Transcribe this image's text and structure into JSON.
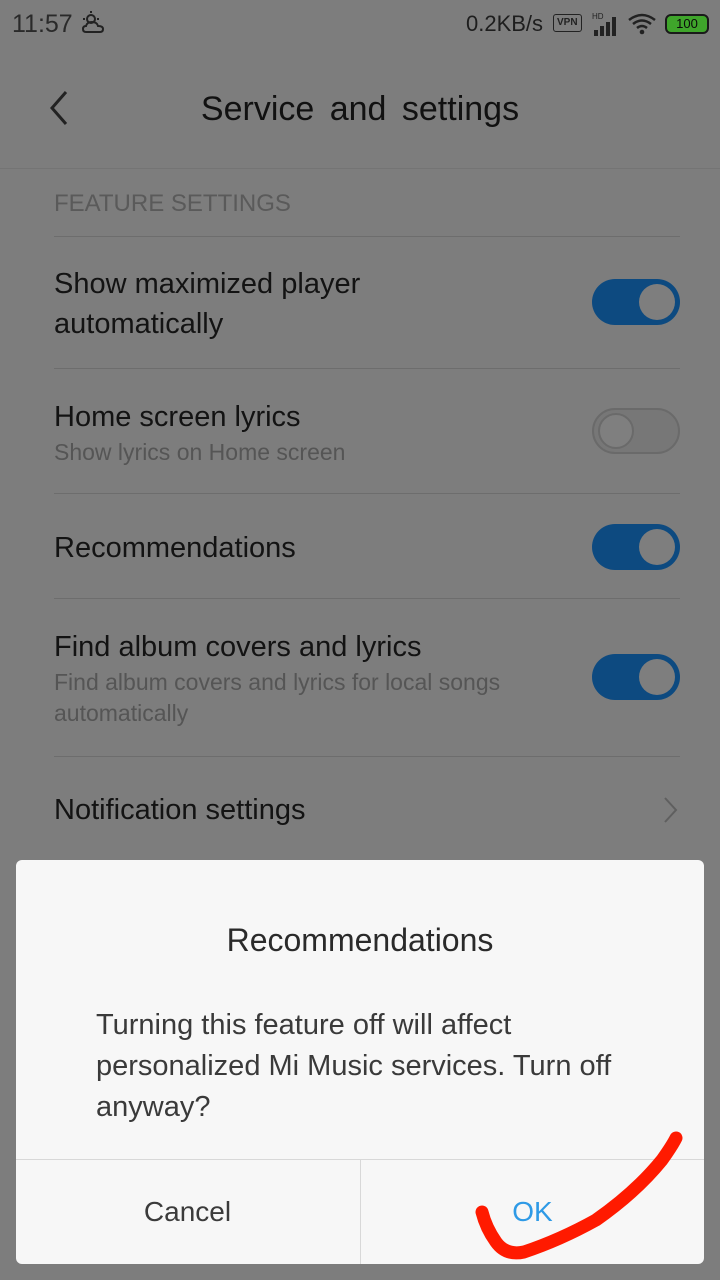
{
  "status_bar": {
    "time": "11:57",
    "net_speed": "0.2KB/s",
    "vpn_label": "VPN",
    "battery": "100",
    "icons": [
      "weather-icon",
      "vpn-icon",
      "signal-icon",
      "wifi-icon",
      "battery-icon"
    ]
  },
  "header": {
    "title": "Service and settings",
    "back_icon": "chevron-left-icon"
  },
  "section": {
    "title": "FEATURE SETTINGS"
  },
  "settings": {
    "show_max_player": {
      "title_line1": "Show maximized player",
      "title_line2": "automatically",
      "enabled": true
    },
    "home_lyrics": {
      "title": "Home screen lyrics",
      "subtitle": "Show lyrics on Home screen",
      "enabled": false
    },
    "recommendations": {
      "title": "Recommendations",
      "enabled": true
    },
    "album_covers": {
      "title": "Find album covers and lyrics",
      "subtitle_line1": "Find album covers and lyrics for local songs",
      "subtitle_line2": "automatically",
      "enabled": true
    },
    "notifications": {
      "title": "Notification settings"
    }
  },
  "dialog": {
    "title": "Recommendations",
    "message": "Turning this feature off will affect personalized Mi Music services. Turn off anyway?",
    "cancel_label": "Cancel",
    "ok_label": "OK"
  },
  "colors": {
    "toggle_on": "#0d4a80",
    "ok_text": "#2e9ae6",
    "annotation": "#ff1a00",
    "overlay_bg": "#7d7d7d"
  }
}
